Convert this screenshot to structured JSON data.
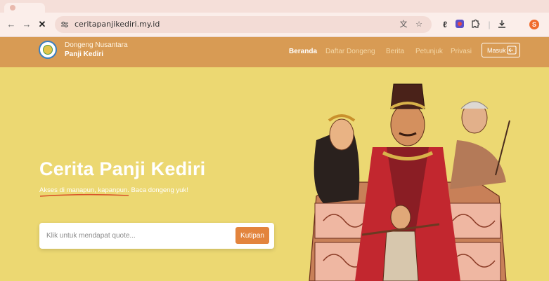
{
  "browser": {
    "url": "ceritapanjikediri.my.id",
    "profile_initial": "S",
    "icons": [
      "back-icon",
      "forward-icon",
      "close-icon",
      "site-info-icon",
      "translate-icon",
      "bookmark-star-icon",
      "extension-icon",
      "screen-record-icon",
      "puzzle-icon",
      "download-icon",
      "profile-avatar"
    ]
  },
  "site": {
    "brand_top": "Dongeng Nusantara",
    "brand_bottom": "Panji Kediri",
    "nav": [
      {
        "label": "Beranda",
        "active": true
      },
      {
        "label": "Daftar Dongeng",
        "active": false
      },
      {
        "label": "Berita",
        "active": false
      },
      {
        "label": "Petunjuk",
        "active": false
      },
      {
        "label": "Privasi",
        "active": false
      }
    ],
    "login_label": "Masuk"
  },
  "hero": {
    "title": "Cerita Panji Kediri",
    "subtitle": "Akses di manapun, kapanpun. Baca dongeng yuk!",
    "quote_placeholder": "Klik untuk mendapat quote...",
    "quote_button": "Kutipan"
  },
  "colors": {
    "header_bg": "#d89b54",
    "hero_bg": "#ecd872",
    "accent": "#e3843d"
  }
}
